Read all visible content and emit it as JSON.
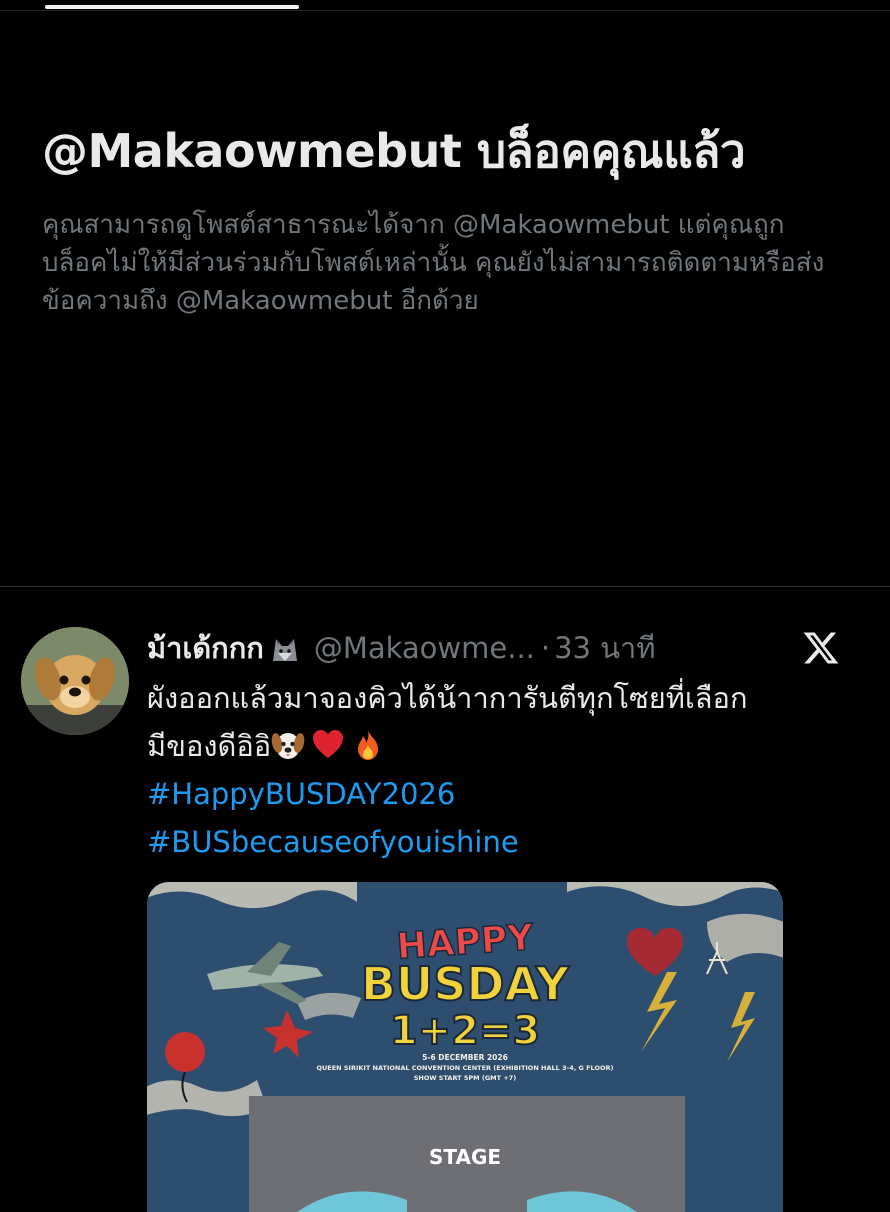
{
  "block_notice": {
    "title": "@Makaowmebut บล็อคคุณแล้ว",
    "description": "คุณสามารถดูโพสต์สาธารณะได้จาก @Makaowmebut แต่คุณถูกบล็อคไม่ให้มีส่วนร่วมกับโพสต์เหล่านั้น คุณยังไม่สามารถติดตามหรือส่งข้อความถึง @Makaowmebut อีกด้วย"
  },
  "tweet": {
    "display_name": "ม้าเด้กกก",
    "name_emoji": "wolf-emoji",
    "handle": "@Makaowme...",
    "separator": "·",
    "time": "33 นาที",
    "text_line1": "ผังออกแล้วมาจองคิวได้น้าาการันตีทุกโซยที่เลือก",
    "text_line2": "มีของดีอิอิ",
    "emojis": [
      "dog-face-emoji",
      "red-heart-emoji",
      "fire-emoji"
    ],
    "hashtags": [
      "#HappyBUSDAY2026",
      "#BUSbecauseofyouishine"
    ],
    "poster": {
      "title_line1": "HAPPY",
      "title_line2": "BUSDAY",
      "title_line3": "1+2=3",
      "date": "5-6 DECEMBER 2026",
      "venue": "QUEEN SIRIKIT NATIONAL CONVENTION CENTER (EXHIBITION HALL 3-4, G FLOOR)",
      "show_time": "SHOW START 5PM (GMT +7)",
      "stage_label": "STAGE"
    }
  },
  "colors": {
    "background": "#000000",
    "text_primary": "#e7e9ea",
    "text_secondary": "#71767b",
    "link": "#1d9bf0",
    "poster_bg": "#2e4e6f"
  }
}
